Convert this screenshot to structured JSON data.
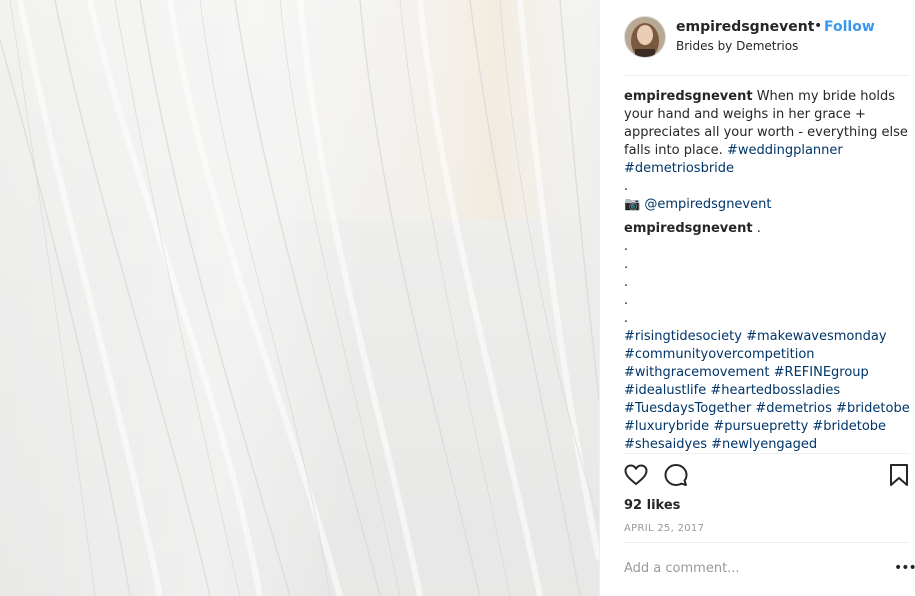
{
  "post": {
    "username": "empiredsgnevent",
    "separator": "•",
    "follow_label": "Follow",
    "location": "Brides by Demetrios",
    "caption": {
      "username": "empiredsgnevent",
      "text_line1": "When my bride holds",
      "text_line2": "your hand and weighs in her grace +",
      "text_line3": "appreciates all your worth - everything else",
      "text_line4": "falls into place.",
      "tag_weddingplanner": "#weddingplanner",
      "tag_demetriosbride": "#demetriosbride",
      "dot": ".",
      "camera_emoji": "📷",
      "mention": "@empiredsgnevent"
    },
    "comment": {
      "username": "empiredsgnevent",
      "text": ".",
      "dots": [
        ".",
        ".",
        ".",
        ".",
        "."
      ],
      "tag_lines": [
        [
          "#risingtidesociety",
          "#makewavesmonday"
        ],
        [
          "#communityovercompetition"
        ],
        [
          "#withgracemovement",
          "#REFINEgroup"
        ],
        [
          "#idealustlife",
          "#heartedbossladies"
        ],
        [
          "#TuesdaysTogether",
          "#demetrios",
          "#bridetobe"
        ],
        [
          "#luxurybride",
          "#pursuepretty",
          "#bridetobe"
        ],
        [
          "#shesaidyes",
          "#newlyengaged"
        ]
      ]
    },
    "likes": "92 likes",
    "date": "APRIL 25, 2017",
    "add_comment_placeholder": "Add a comment...",
    "more_options": "•••"
  },
  "icons": {
    "like": "heart-icon",
    "comment": "comment-bubble-icon",
    "save": "bookmark-icon",
    "more": "more-options-icon"
  },
  "colors": {
    "link": "#003569",
    "follow": "#3897f0",
    "muted": "#999999",
    "text": "#262626"
  }
}
